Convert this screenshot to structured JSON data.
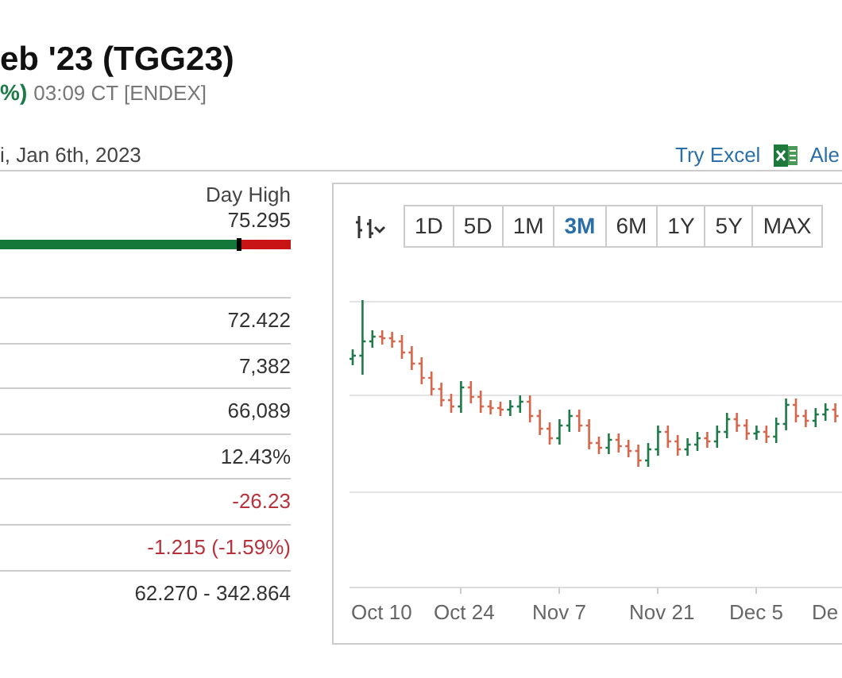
{
  "header": {
    "title": "eb '23 (TGG23)",
    "change": "%)",
    "time_exchange": "03:09 CT [ENDEX]",
    "date": "i, Jan 6th, 2023"
  },
  "links": [
    {
      "kind": "excel",
      "label": "Try Excel"
    },
    {
      "kind": "plain",
      "label": "Ale"
    }
  ],
  "day_range": {
    "label": "Day High",
    "value": "75.295",
    "level": 0.82
  },
  "stats": [
    {
      "value": "72.422",
      "kind": "plain"
    },
    {
      "value": "7,382",
      "kind": "plain"
    },
    {
      "value": "66,089",
      "kind": "plain"
    },
    {
      "value": "12.43%",
      "kind": "plain"
    },
    {
      "value": "-26.23",
      "kind": "loss"
    },
    {
      "value": "-1.215 (-1.59%)",
      "kind": "loss"
    },
    {
      "value": "62.270 - 342.864",
      "kind": "plain"
    }
  ],
  "chart": {
    "periods": [
      {
        "label": "1D",
        "selected": false
      },
      {
        "label": "5D",
        "selected": false
      },
      {
        "label": "1M",
        "selected": false
      },
      {
        "label": "3M",
        "selected": true
      },
      {
        "label": "6M",
        "selected": false
      },
      {
        "label": "1Y",
        "selected": false
      },
      {
        "label": "5Y",
        "selected": false
      },
      {
        "label": "MAX",
        "selected": false
      }
    ],
    "x_labels": [
      "Oct 10",
      "Oct 24",
      "Nov 7",
      "Nov 21",
      "Dec 5",
      "De"
    ]
  }
}
